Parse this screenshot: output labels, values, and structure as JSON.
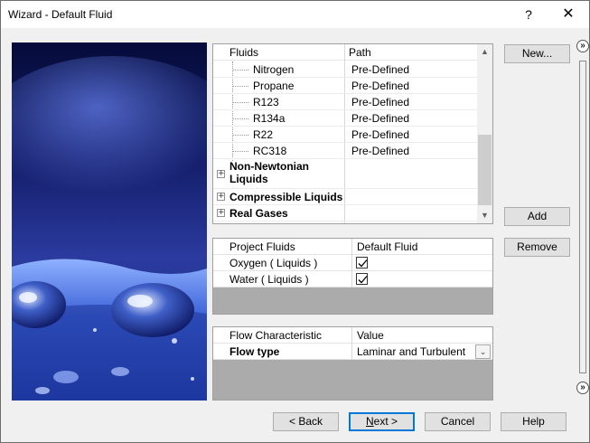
{
  "window": {
    "title": "Wizard - Default Fluid",
    "help_glyph": "?",
    "close_glyph": "✕"
  },
  "fluids_table": {
    "columns": [
      "Fluids",
      "Path"
    ],
    "rows": [
      {
        "name": "Nitrogen",
        "path": "Pre-Defined"
      },
      {
        "name": "Propane",
        "path": "Pre-Defined"
      },
      {
        "name": "R123",
        "path": "Pre-Defined"
      },
      {
        "name": "R134a",
        "path": "Pre-Defined"
      },
      {
        "name": "R22",
        "path": "Pre-Defined"
      },
      {
        "name": "RC318",
        "path": "Pre-Defined"
      }
    ],
    "groups": [
      {
        "name": "Non-Newtonian Liquids",
        "line1": "Non-Newtonian",
        "line2": "Liquids",
        "expander": "+"
      },
      {
        "name": "Compressible Liquids",
        "expander": "+"
      },
      {
        "name": "Real Gases",
        "expander": "+"
      }
    ],
    "scroll_up_glyph": "▲",
    "scroll_down_glyph": "▼"
  },
  "project_fluids": {
    "columns": [
      "Project Fluids",
      "Default Fluid"
    ],
    "rows": [
      {
        "name": "Oxygen ( Liquids )",
        "default": true
      },
      {
        "name": "Water ( Liquids )",
        "default": true
      }
    ]
  },
  "flow": {
    "columns": [
      "Flow Characteristic",
      "Value"
    ],
    "row": {
      "name": "Flow type",
      "value": "Laminar and Turbulent",
      "dropdown_glyph": "⌄"
    }
  },
  "buttons": {
    "new": "New...",
    "add": "Add",
    "remove": "Remove",
    "back_arrow": "<",
    "back_rest": " Back",
    "back_prefix": "",
    "next_u": "N",
    "next_rest": "ext >",
    "cancel": "Cancel",
    "help": "Help"
  },
  "side_nav": {
    "top_glyph": "»",
    "bottom_glyph": "»"
  },
  "colors": {
    "accent": "#0078d7",
    "gray_area": "#ababab",
    "button_face": "#e1e1e1"
  }
}
